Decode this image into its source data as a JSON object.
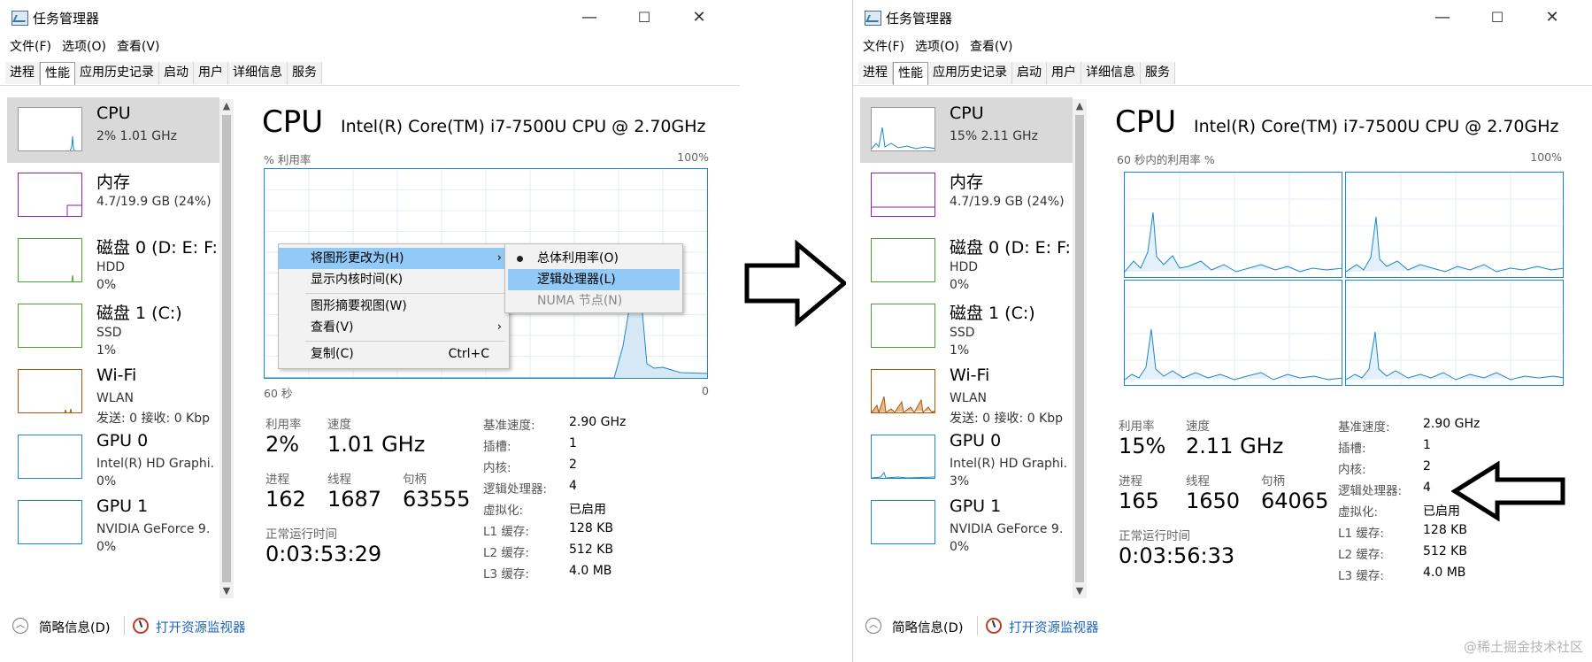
{
  "left_window": {
    "title": "任务管理器",
    "window_controls": {
      "minimize": "—",
      "maximize": "☐",
      "close": "✕"
    },
    "menu": [
      "文件(F)",
      "选项(O)",
      "查看(V)"
    ],
    "tabs": [
      "进程",
      "性能",
      "应用历史记录",
      "启动",
      "用户",
      "详细信息",
      "服务"
    ],
    "active_tab": "性能",
    "sidebar": [
      {
        "name": "CPU",
        "line1": "2% 1.01 GHz",
        "line2": "",
        "color": "#1e88c7",
        "selected": true
      },
      {
        "name": "内存",
        "line1": "4.7/19.9 GB (24%)",
        "line2": "",
        "color": "#8b23a4",
        "selected": false
      },
      {
        "name": "磁盘 0 (D: E: F:",
        "line1": "HDD",
        "line2": "0%",
        "color": "#4da02f",
        "selected": false
      },
      {
        "name": "磁盘 1 (C:)",
        "line1": "SSD",
        "line2": "1%",
        "color": "#4da02f",
        "selected": false
      },
      {
        "name": "Wi-Fi",
        "line1": "WLAN",
        "line2": "发送: 0 接收: 0 Kbp",
        "color": "#a7590e",
        "selected": false
      },
      {
        "name": "GPU 0",
        "line1": "Intel(R) HD Graphi.",
        "line2": "0%",
        "color": "#1e88c7",
        "selected": false
      },
      {
        "name": "GPU 1",
        "line1": "NVIDIA GeForce 9.",
        "line2": "0%",
        "color": "#1e88c7",
        "selected": false
      }
    ],
    "main": {
      "title": "CPU",
      "model": "Intel(R) Core(TM) i7-7500U CPU @ 2.70GHz",
      "graph_label": "% 利用率",
      "graph_max": "100%",
      "axis_left": "60 秒",
      "axis_right": "0",
      "stats": {
        "utilization_label": "利用率",
        "utilization": "2%",
        "speed_label": "速度",
        "speed": "1.01 GHz",
        "processes_label": "进程",
        "processes": "162",
        "threads_label": "线程",
        "threads": "1687",
        "handles_label": "句柄",
        "handles": "63555",
        "uptime_label": "正常运行时间",
        "uptime": "0:03:53:29"
      },
      "specs": [
        {
          "k": "基准速度:",
          "v": "2.90 GHz"
        },
        {
          "k": "插槽:",
          "v": "1"
        },
        {
          "k": "内核:",
          "v": "2"
        },
        {
          "k": "逻辑处理器:",
          "v": "4"
        },
        {
          "k": "虚拟化:",
          "v": "已启用"
        },
        {
          "k": "L1 缓存:",
          "v": "128 KB"
        },
        {
          "k": "L2 缓存:",
          "v": "512 KB"
        },
        {
          "k": "L3 缓存:",
          "v": "4.0 MB"
        }
      ]
    },
    "context_menu": {
      "items": [
        {
          "label": "将图形更改为(H)",
          "shortcut": "",
          "submenu": true,
          "highlighted": true
        },
        {
          "label": "显示内核时间(K)",
          "shortcut": "",
          "submenu": false,
          "highlighted": false
        },
        {
          "label": "图形摘要视图(W)",
          "shortcut": "",
          "submenu": false,
          "highlighted": false
        },
        {
          "label": "查看(V)",
          "shortcut": "",
          "submenu": true,
          "highlighted": false
        },
        {
          "label": "复制(C)",
          "shortcut": "Ctrl+C",
          "submenu": false,
          "highlighted": false
        }
      ],
      "submenu_items": [
        {
          "label": "总体利用率(O)",
          "checked": true,
          "highlighted": false,
          "disabled": false
        },
        {
          "label": "逻辑处理器(L)",
          "checked": false,
          "highlighted": true,
          "disabled": false
        },
        {
          "label": "NUMA 节点(N)",
          "checked": false,
          "highlighted": false,
          "disabled": true
        }
      ]
    },
    "footer": {
      "fewer_details": "简略信息(D)",
      "resource_monitor": "打开资源监视器"
    }
  },
  "right_window": {
    "title": "任务管理器",
    "window_controls": {
      "minimize": "—",
      "maximize": "☐",
      "close": "✕"
    },
    "menu": [
      "文件(F)",
      "选项(O)",
      "查看(V)"
    ],
    "tabs": [
      "进程",
      "性能",
      "应用历史记录",
      "启动",
      "用户",
      "详细信息",
      "服务"
    ],
    "active_tab": "性能",
    "sidebar": [
      {
        "name": "CPU",
        "line1": "15% 2.11 GHz",
        "line2": "",
        "color": "#1e88c7",
        "selected": true
      },
      {
        "name": "内存",
        "line1": "4.7/19.9 GB (24%)",
        "line2": "",
        "color": "#8b23a4",
        "selected": false
      },
      {
        "name": "磁盘 0 (D: E: F:",
        "line1": "HDD",
        "line2": "0%",
        "color": "#4da02f",
        "selected": false
      },
      {
        "name": "磁盘 1 (C:)",
        "line1": "SSD",
        "line2": "1%",
        "color": "#4da02f",
        "selected": false
      },
      {
        "name": "Wi-Fi",
        "line1": "WLAN",
        "line2": "发送: 0 接收: 0 Kbp",
        "color": "#a7590e",
        "selected": false
      },
      {
        "name": "GPU 0",
        "line1": "Intel(R) HD Graphi.",
        "line2": "3%",
        "color": "#1e88c7",
        "selected": false
      },
      {
        "name": "GPU 1",
        "line1": "NVIDIA GeForce 9.",
        "line2": "0%",
        "color": "#1e88c7",
        "selected": false
      }
    ],
    "main": {
      "title": "CPU",
      "model": "Intel(R) Core(TM) i7-7500U CPU @ 2.70GHz",
      "graph_label": "60 秒内的利用率 %",
      "graph_max": "100%",
      "stats": {
        "utilization_label": "利用率",
        "utilization": "15%",
        "speed_label": "速度",
        "speed": "2.11 GHz",
        "processes_label": "进程",
        "processes": "165",
        "threads_label": "线程",
        "threads": "1650",
        "handles_label": "句柄",
        "handles": "64065",
        "uptime_label": "正常运行时间",
        "uptime": "0:03:56:33"
      },
      "specs": [
        {
          "k": "基准速度:",
          "v": "2.90 GHz"
        },
        {
          "k": "插槽:",
          "v": "1"
        },
        {
          "k": "内核:",
          "v": "2"
        },
        {
          "k": "逻辑处理器:",
          "v": "4"
        },
        {
          "k": "虚拟化:",
          "v": "已启用"
        },
        {
          "k": "L1 缓存:",
          "v": "128 KB"
        },
        {
          "k": "L2 缓存:",
          "v": "512 KB"
        },
        {
          "k": "L3 缓存:",
          "v": "4.0 MB"
        }
      ]
    },
    "footer": {
      "fewer_details": "简略信息(D)",
      "resource_monitor": "打开资源监视器"
    }
  },
  "watermark": "@稀土掘金技术社区",
  "colors": {
    "cpu": "#1e88c7",
    "memory": "#8b23a4",
    "disk": "#4da02f",
    "wifi": "#a7590e",
    "highlight": "#91c9f7",
    "link": "#1b65c2"
  }
}
